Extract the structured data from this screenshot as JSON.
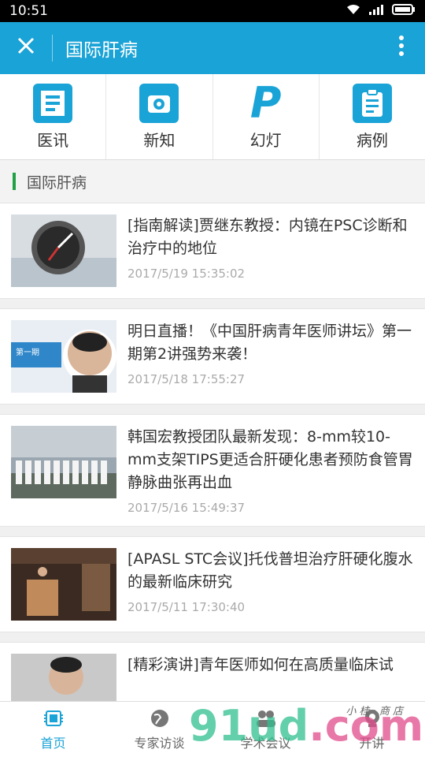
{
  "status": {
    "time": "10:51"
  },
  "header": {
    "title": "国际肝病"
  },
  "quick": [
    {
      "label": "医讯",
      "icon": "document-icon"
    },
    {
      "label": "新知",
      "icon": "camera-icon"
    },
    {
      "label": "幻灯",
      "icon": "slides-p-icon"
    },
    {
      "label": "病例",
      "icon": "clipboard-icon"
    }
  ],
  "section": {
    "label": "国际肝病"
  },
  "articles": [
    {
      "title": "[指南解读]贾继东教授：内镜在PSC诊断和治疗中的地位",
      "date": "2017/5/19 15:35:02"
    },
    {
      "title": "明日直播！《中国肝病青年医师讲坛》第一期第2讲强势来袭！",
      "date": "2017/5/18 17:55:27",
      "thumb_text": "第一期"
    },
    {
      "title": "韩国宏教授团队最新发现：8-mm较10-mm支架TIPS更适合肝硬化患者预防食管胃静脉曲张再出血",
      "date": "2017/5/16 15:49:37"
    },
    {
      "title": "[APASL STC会议]托伐普坦治疗肝硬化腹水的最新临床研究",
      "date": "2017/5/11 17:30:40"
    },
    {
      "title": "[精彩演讲]青年医师如何在高质量临床试",
      "date": ""
    }
  ],
  "tabs": [
    {
      "label": "首页",
      "icon": "chip-icon",
      "active": true
    },
    {
      "label": "专家访谈",
      "icon": "globe-icon",
      "active": false
    },
    {
      "label": "学术会议",
      "icon": "people-icon",
      "active": false
    },
    {
      "label": "开讲",
      "icon": "video-icon",
      "active": false
    }
  ],
  "watermark": {
    "text": "91ud",
    "suffix": ".com",
    "small": "小 桂 · 商 店"
  },
  "colors": {
    "primary": "#1aa3d6",
    "accent_green": "#22a045"
  }
}
